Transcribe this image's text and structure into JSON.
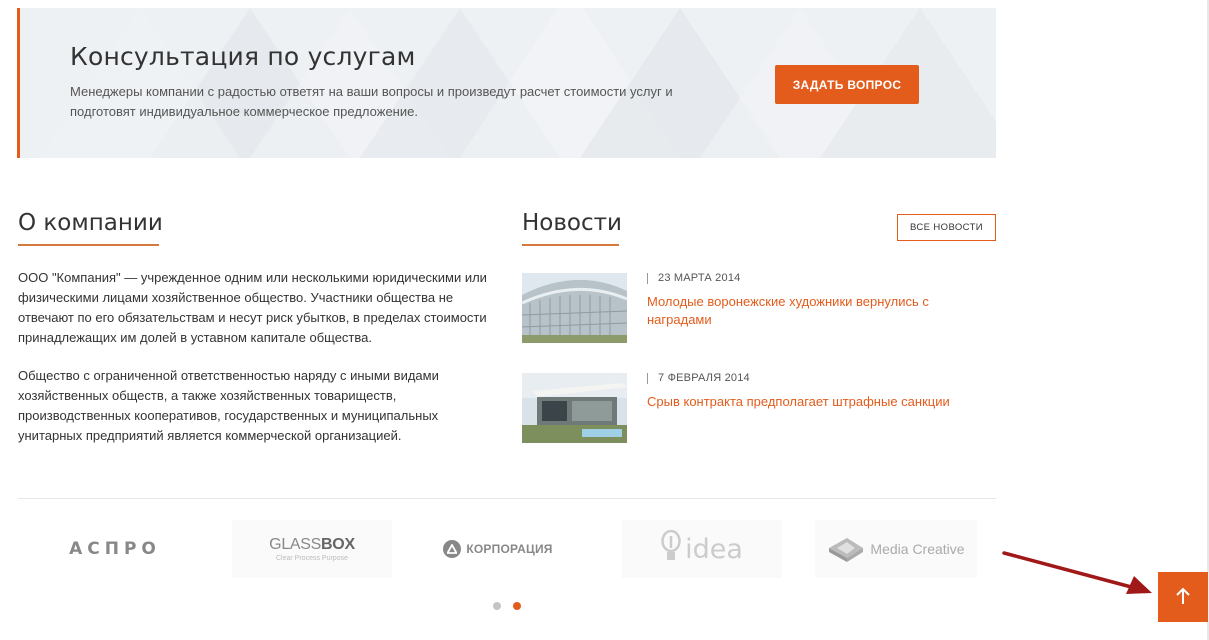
{
  "consultation": {
    "title": "Консультация по услугам",
    "text": "Менеджеры компании с радостью ответят на ваши вопросы и произведут расчет стоимости услуг и подготовят индивидуальное коммерческое предложение.",
    "button_label": "ЗАДАТЬ ВОПРОС"
  },
  "about": {
    "title": "О компании",
    "paragraph_1": "ООО \"Компания\" — учрежденное одним или несколькими юридическими или физическими лицами хозяйственное общество. Участники общества не отвечают по его обязательствам и несут риск убытков, в пределах стоимости принадлежащих им долей в уставном капитале общества.",
    "paragraph_2": "Общество с ограниченной ответственностью наряду с иными видами хозяйственных обществ, а также хозяйственных товариществ, производственных кооперативов, государственных и муниципальных унитарных предприятий является коммерческой организацией."
  },
  "news": {
    "title": "Новости",
    "all_news_label": "ВСЕ НОВОСТИ",
    "items": [
      {
        "date": "23 МАРТА 2014",
        "title": "Молодые воронежские художники вернулись с наградами"
      },
      {
        "date": "7 ФЕВРАЛЯ 2014",
        "title": "Срыв контракта предполагает штрафные санкции"
      }
    ]
  },
  "partners": {
    "logos": [
      {
        "name": "АСПРО"
      },
      {
        "name_light": "GLASS",
        "name_bold": "BOX",
        "tagline": "Clear Process Purpose"
      },
      {
        "name": "КОРПОРАЦИЯ"
      },
      {
        "name": "idea"
      },
      {
        "name": "Media Creative"
      }
    ],
    "pagination": {
      "pages": 2,
      "active": 2
    }
  },
  "colors": {
    "accent": "#e35c1c",
    "annotation_arrow": "#a01818"
  },
  "icons": {
    "scroll_top": "arrow-up-icon"
  }
}
